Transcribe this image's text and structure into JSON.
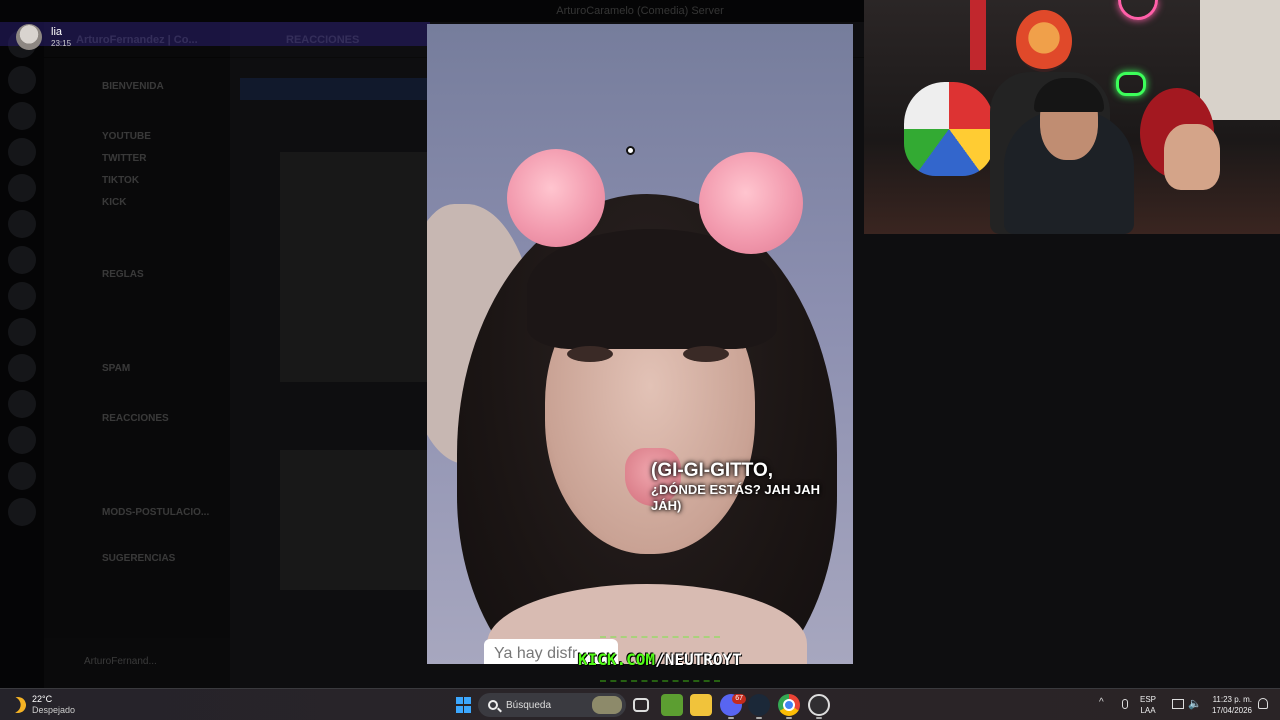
{
  "discord": {
    "window_title": "ArturoCaramelo (Comedia) Server",
    "server_name": "ArturoFernandez | Co...",
    "channel_header": "REACCIONES",
    "channels": [
      "BIENVENIDA",
      "YOUTUBE",
      "TWITTER",
      "TIKTOK",
      "KICK",
      "REGLAS",
      "SPAM",
      "REACCIONES",
      "MODS-POSTULACIO...",
      "SUGERENCIAS"
    ],
    "user_name": "ArturoFernand..."
  },
  "notification": {
    "name": "lia",
    "time": "23:15"
  },
  "video": {
    "subtitle_line1": "(GI-GI-GITTO,",
    "subtitle_line2": "¿DÓNDE ESTÁS? JAH JAH",
    "subtitle_line3": "JÁH)",
    "caption_box": "Ya hay disfr"
  },
  "overlay": {
    "kick": "KICK.COM",
    "handle": "/NEUTROYT",
    "kick_color": "#53fc18"
  },
  "taskbar": {
    "weather_temp": "22°C",
    "weather_condition": "Despejado",
    "search_placeholder": "Búsqueda",
    "discord_badge": "67",
    "language_top": "ESP",
    "language_bottom": "LAA",
    "time": "11:23 p. m.",
    "date": "17/04/2026",
    "icons": [
      "windows-start-icon",
      "search-icon",
      "task-view-icon",
      "minecraft-icon",
      "file-explorer-icon",
      "discord-icon",
      "steam-icon",
      "chrome-icon",
      "obs-icon",
      "chevron-up-icon",
      "microphone-icon",
      "network-icon",
      "volume-icon",
      "bell-icon"
    ]
  }
}
